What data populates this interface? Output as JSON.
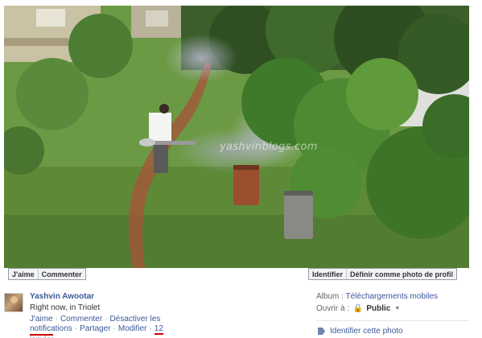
{
  "photo": {
    "watermark": "yashvinblogs.com",
    "alt": "Man fogging a garden with a mosquito fogger"
  },
  "photo_actions": {
    "like_label": "J'aime",
    "comment_label": "Commenter",
    "tag_label": "Identifier",
    "profile_label": "Définir comme photo de profil"
  },
  "post": {
    "author": "Yashvin Awootar",
    "location": "Right now, in Triolet",
    "actions": {
      "like": "J'aime",
      "comment": "Commenter",
      "disable_notifications": "Désactiver les notifications",
      "share": "Partager",
      "edit": "Modifier",
      "date_day": "12",
      "date_month": "janvier"
    }
  },
  "meta": {
    "album_label": "Album :",
    "album_name": "Téléchargements mobiles",
    "open_label": "Ouvrir à :",
    "audience": "Public",
    "tag_photo": "Identifier cette photo"
  },
  "colors": {
    "link": "#3b5998",
    "highlight_underline": "#d00000"
  }
}
